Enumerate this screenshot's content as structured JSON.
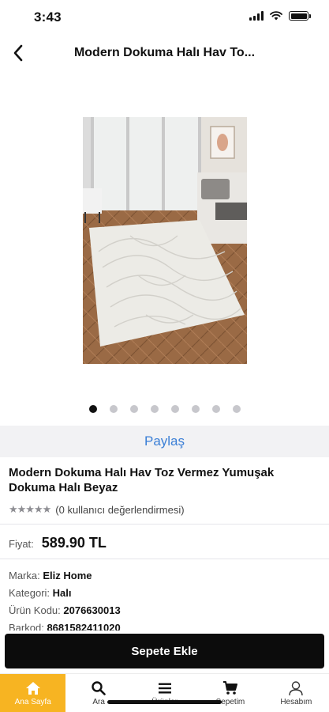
{
  "status_bar": {
    "time": "3:43"
  },
  "nav": {
    "title": "Modern Dokuma Halı Hav To..."
  },
  "gallery": {
    "image_count": 8,
    "active_index": 0
  },
  "share": {
    "label": "Paylaş"
  },
  "product": {
    "title": "Modern Dokuma Halı Hav Toz Vermez Yumuşak Dokuma Halı Beyaz",
    "rating_text": "(0 kullanıcı değerlendirmesi)",
    "rating_value": 0,
    "price_label": "Fiyat:",
    "price": "589.90 TL",
    "specs": [
      {
        "label": "Marka:",
        "value": "Eliz Home"
      },
      {
        "label": "Kategori:",
        "value": "Halı"
      },
      {
        "label": "Ürün Kodu:",
        "value": "2076630013"
      },
      {
        "label": "Barkod:",
        "value": "8681582411020"
      }
    ]
  },
  "cart_button": {
    "label": "Sepete Ekle"
  },
  "tabs": [
    {
      "label": "Ana Sayfa",
      "icon": "home-icon",
      "active": true
    },
    {
      "label": "Ara",
      "icon": "search-icon",
      "active": false
    },
    {
      "label": "Ürünler",
      "icon": "menu-icon",
      "active": false
    },
    {
      "label": "Sepetim",
      "icon": "cart-icon",
      "active": false
    },
    {
      "label": "Hesabım",
      "icon": "user-icon",
      "active": false
    }
  ],
  "colors": {
    "accent": "#f7b422",
    "link": "#3b7fd6",
    "button": "#0c0c0c"
  }
}
